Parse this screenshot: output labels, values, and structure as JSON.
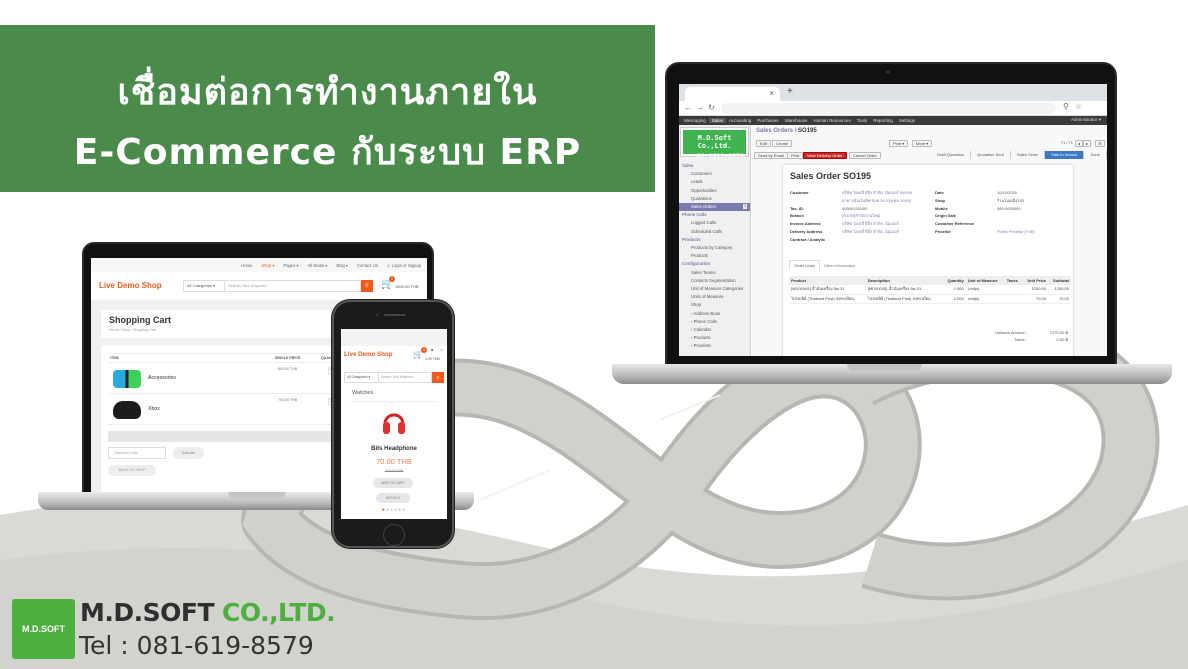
{
  "banner": {
    "line1": "เชื่อมต่อการทำงานภายใน",
    "line2": "E-Commerce กับระบบ ERP",
    "background": "#4a8a4a"
  },
  "erp": {
    "browser": {
      "new_tab": "+",
      "close_tab": "×",
      "nav_icons": [
        "back-icon",
        "forward-icon",
        "reload-icon"
      ]
    },
    "menu": [
      "Messaging",
      "Sales",
      "Accounting",
      "Purchases",
      "Warehouse",
      "Human Resources",
      "Tools",
      "Reporting",
      "Settings"
    ],
    "active_menu": "Sales",
    "user": "Administrator ▾",
    "company": {
      "name": "M.D.Soft Co.,Ltd.",
      "phone": "✆: 08-1619-8579",
      "color": "#3fb34f"
    },
    "sidebar": [
      {
        "label": "Sales",
        "type": "header"
      },
      {
        "label": "Customers"
      },
      {
        "label": "Leads"
      },
      {
        "label": "Opportunities"
      },
      {
        "label": "Quotations"
      },
      {
        "label": "Sales Orders",
        "selected": true
      },
      {
        "label": "Phone Calls",
        "type": "header"
      },
      {
        "label": "Logged Calls"
      },
      {
        "label": "Scheduled Calls"
      },
      {
        "label": "Products",
        "type": "header"
      },
      {
        "label": "Products by Category"
      },
      {
        "label": "Products"
      },
      {
        "label": "Configuration",
        "type": "header"
      },
      {
        "label": "Sales Teams"
      },
      {
        "label": "Contacts Segmentation"
      },
      {
        "label": "Unit of Measure Categories"
      },
      {
        "label": "Units of Measure"
      },
      {
        "label": "Shop"
      },
      {
        "label": "Address Book",
        "type": "collapsed"
      },
      {
        "label": "Phone Calls",
        "type": "collapsed"
      },
      {
        "label": "Calendar",
        "type": "collapsed"
      },
      {
        "label": "Products",
        "type": "collapsed"
      },
      {
        "label": "Pricelists",
        "type": "collapsed"
      }
    ],
    "breadcrumb": {
      "parent": "Sales Orders",
      "sep": " / ",
      "current": "SO195"
    },
    "buttons": {
      "edit": "Edit",
      "create": "Create",
      "print": "Print ▾",
      "more": "More ▾",
      "send_email": "Send by Email",
      "print2": "Print",
      "view_delivery": "View Delivery Order",
      "cancel": "Cancel Order"
    },
    "pager": "71 / 71",
    "status_steps": [
      "Draft Quotation",
      "Quotation Sent",
      "Sales Order",
      "Sale to Invoice",
      "Done"
    ],
    "current_step": "Sale to Invoice",
    "title": "Sales Order SO195",
    "left_fields": [
      {
        "label": "Customer",
        "value": "บริษัท ไอเดลี่ ดีลิ่ง จำกัด, นัมเบอร์ 999/95 อาคารมั่นเงินทิพ ซอย 34 กรุงเทพ 10900",
        "link": true
      },
      {
        "label": "Tax. ID.",
        "value": "0000012010l0",
        "link": false
      },
      {
        "label": "Branch",
        "value": "[00000]สำนักงานใหญ่",
        "link": true
      },
      {
        "label": "Invoice Address",
        "value": "บริษัท ไอเดลี่ ดีลิ่ง จำกัด, นัมเบอร์",
        "link": true
      },
      {
        "label": "Delivery Address",
        "value": "บริษัท ไอเดลี่ ดีลิ่ง จำกัด, นัมเบอร์",
        "link": true
      },
      {
        "label": "Contract / Analytic",
        "value": "",
        "link": false
      }
    ],
    "right_fields": [
      {
        "label": "Date",
        "value": "10/10/2020",
        "link": false
      },
      {
        "label": "Shop",
        "value": "ร้านโมเดลิ่งโปร",
        "link": false
      },
      {
        "label": "Mobile",
        "value": "089-0000000",
        "link": false
      },
      {
        "label": "Origin Sale",
        "value": "",
        "link": false
      },
      {
        "label": "Customer Reference",
        "value": "",
        "link": false
      },
      {
        "label": "Pricelist",
        "value": "Public Pricelist (THB)",
        "link": true
      }
    ],
    "tabs": [
      "Order Lines",
      "Other Information"
    ],
    "order_columns": [
      "Product",
      "Description",
      "Quantity",
      "Unit of Measure",
      "Taxes",
      "Unit Price",
      "Subtotal"
    ],
    "order_lines": [
      {
        "product": "[MD00005] น้ำมันเครื่อง 5w-31",
        "description": "[MD00005] น้ำมันเครื่อง 5w-31",
        "quantity": "1.000",
        "uom": "Unit(s)",
        "taxes": "",
        "unit_price": "1200.00",
        "subtotal": "1200.00"
      },
      {
        "product": "ไปรษณีย์ (Thailand Post) ลงทะเบียน",
        "description": "ไปรษณีย์ (Thailand Post) ลงทะเบียน",
        "quantity": "1.000",
        "uom": "Unit(s)",
        "taxes": "",
        "unit_price": "70.00",
        "subtotal": "70.00"
      }
    ],
    "totals": {
      "untaxed_label": "Untaxed Amount :",
      "untaxed": "1270.00 ฿",
      "taxes_label": "Taxes :",
      "taxes": "0.00 ฿"
    }
  },
  "shop": {
    "topnav": [
      "Home",
      "Shop ▾",
      "Pages ▾",
      "All Deals ▾",
      "Blog ▾",
      "Contact Us",
      "⚠ Login or Signup"
    ],
    "brand": "Live Demo Shop",
    "category": "All Categories ▾",
    "search_placeholder": "Search Your Keyword",
    "cart_count": "0",
    "cart_amount": "1500.00 THB",
    "cart_title": "Shopping Cart",
    "breadcrumb": "Home / Shop / Shopping Cart",
    "columns": [
      "ITEM",
      "SINGLE PRICE",
      "QUANTITY"
    ],
    "items": [
      {
        "name": "Accessories",
        "price": "800.00 THB",
        "qty": "1"
      },
      {
        "name": "Xbox",
        "price": "700.00 THB",
        "qty": "1"
      }
    ],
    "discount_placeholder": "Discount code",
    "activate": "Activate",
    "back": "BACK TO SHOP"
  },
  "phone": {
    "brand": "Live Demo Shop",
    "cart_count": "0",
    "cart_amount": "0.00 THB",
    "category": "All Categories ▾",
    "search_placeholder": "Search Your Keyword",
    "section": "Watches",
    "product": "Bits Headphone",
    "price": "70.00 THB",
    "old_price": "100.00 THB",
    "add_to_cart": "ADD TO CART",
    "details": "DETAILS",
    "slides_total": 6,
    "slide_active": 1
  },
  "footer": {
    "logo_text": "M.D.SOFT",
    "company": "M.D.SOFT",
    "suffix": "CO.,LTD.",
    "tel": "Tel : 081-619-8579",
    "accent": "#4caf3e"
  }
}
